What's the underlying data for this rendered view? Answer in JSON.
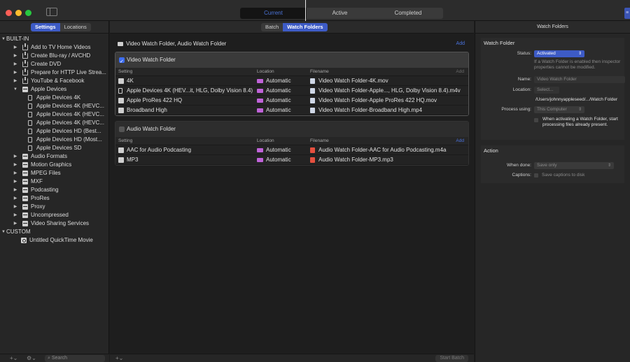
{
  "colors": {
    "accent": "#3d5bc6",
    "link": "#4a73e0",
    "folder": "#c063d9",
    "light_red": "#fe5f57",
    "light_yellow": "#febc2e",
    "light_green": "#28c840"
  },
  "titlebar": {
    "tabs": [
      {
        "label": "Current"
      },
      {
        "label": "Active"
      },
      {
        "label": "Completed"
      }
    ]
  },
  "sidebar": {
    "tabs": [
      {
        "label": "Settings"
      },
      {
        "label": "Locations"
      }
    ],
    "builtin_label": "BUILT-IN",
    "custom_label": "CUSTOM",
    "items": [
      {
        "label": "Add to TV Home Videos",
        "icon": "share-icon"
      },
      {
        "label": "Create Blu-ray / AVCHD",
        "icon": "share-icon"
      },
      {
        "label": "Create DVD",
        "icon": "share-icon"
      },
      {
        "label": "Prepare for HTTP Live Strea...",
        "icon": "share-icon"
      },
      {
        "label": "YouTube & Facebook",
        "icon": "share-icon"
      },
      {
        "label": "Apple Devices",
        "icon": "group-icon"
      },
      {
        "label": "Apple Devices 4K",
        "icon": "device-icon"
      },
      {
        "label": "Apple Devices 4K (HEVC...",
        "icon": "device-icon"
      },
      {
        "label": "Apple Devices 4K (HEVC...",
        "icon": "device-icon"
      },
      {
        "label": "Apple Devices 4K (HEVC...",
        "icon": "device-icon"
      },
      {
        "label": "Apple Devices HD (Best...",
        "icon": "device-icon"
      },
      {
        "label": "Apple Devices HD (Most...",
        "icon": "device-icon"
      },
      {
        "label": "Apple Devices SD",
        "icon": "device-icon"
      },
      {
        "label": "Audio Formats",
        "icon": "group-icon"
      },
      {
        "label": "Motion Graphics",
        "icon": "group-icon"
      },
      {
        "label": "MPEG Files",
        "icon": "group-icon"
      },
      {
        "label": "MXF",
        "icon": "group-icon"
      },
      {
        "label": "Podcasting",
        "icon": "group-icon"
      },
      {
        "label": "ProRes",
        "icon": "group-icon"
      },
      {
        "label": "Proxy",
        "icon": "group-icon"
      },
      {
        "label": "Uncompressed",
        "icon": "group-icon"
      },
      {
        "label": "Video Sharing Services",
        "icon": "group-icon"
      }
    ],
    "custom_items": [
      {
        "label": "Untitled QuickTime Movie",
        "icon": "quicktime-icon"
      }
    ],
    "footer": {
      "add": "+⌄",
      "action": "⚙⌄",
      "search_placeholder": "Search"
    }
  },
  "main": {
    "tabs": [
      {
        "label": "Batch"
      },
      {
        "label": "Watch Folders"
      }
    ],
    "header_title": "Video Watch Folder, Audio Watch Folder",
    "header_add": "Add",
    "video_group": {
      "title": "Video Watch Folder",
      "columns": {
        "setting": "Setting",
        "location": "Location",
        "filename": "Filename",
        "add": "Add"
      },
      "rows": [
        {
          "setting": "4K",
          "location": "Automatic",
          "filename": "Video Watch Folder-4K.mov"
        },
        {
          "setting": "Apple Devices 4K (HEV...it, HLG, Dolby Vision 8.4)",
          "location": "Automatic",
          "filename": "Video Watch Folder-Apple..., HLG, Dolby Vision 8.4).m4v"
        },
        {
          "setting": "Apple ProRes 422 HQ",
          "location": "Automatic",
          "filename": "Video Watch Folder-Apple ProRes 422 HQ.mov"
        },
        {
          "setting": "Broadband High",
          "location": "Automatic",
          "filename": "Video Watch Folder-Broadband High.mp4"
        }
      ]
    },
    "audio_group": {
      "title": "Audio Watch Folder",
      "columns": {
        "setting": "Setting",
        "location": "Location",
        "filename": "Filename",
        "add": "Add"
      },
      "rows": [
        {
          "setting": "AAC for Audio Podcasting",
          "location": "Automatic",
          "filename": "Audio Watch Folder-AAC for Audio Podcasting.m4a"
        },
        {
          "setting": "MP3",
          "location": "Automatic",
          "filename": "Audio Watch Folder-MP3.mp3"
        }
      ]
    },
    "footer": {
      "add": "+⌄",
      "start_batch": "Start Batch"
    }
  },
  "inspector": {
    "title": "Watch Folders",
    "watch_folder": {
      "heading": "Watch Folder",
      "status_label": "Status:",
      "status_value": "Activated",
      "status_note": "If a Watch Folder is enabled then inspector properties cannot be modified.",
      "name_label": "Name:",
      "name_value": "Video Watch Folder",
      "location_label": "Location:",
      "location_button": "Select...",
      "location_path": "/Users/johnnyappleseed/.../Watch Folder",
      "process_label": "Process using:",
      "process_value": "This Computer",
      "start_option": "When activating a Watch Folder, start processing files already present."
    },
    "action": {
      "heading": "Action",
      "when_done_label": "When done:",
      "when_done_value": "Save only",
      "captions_label": "Captions:",
      "captions_value": "Save captions to disk"
    }
  }
}
